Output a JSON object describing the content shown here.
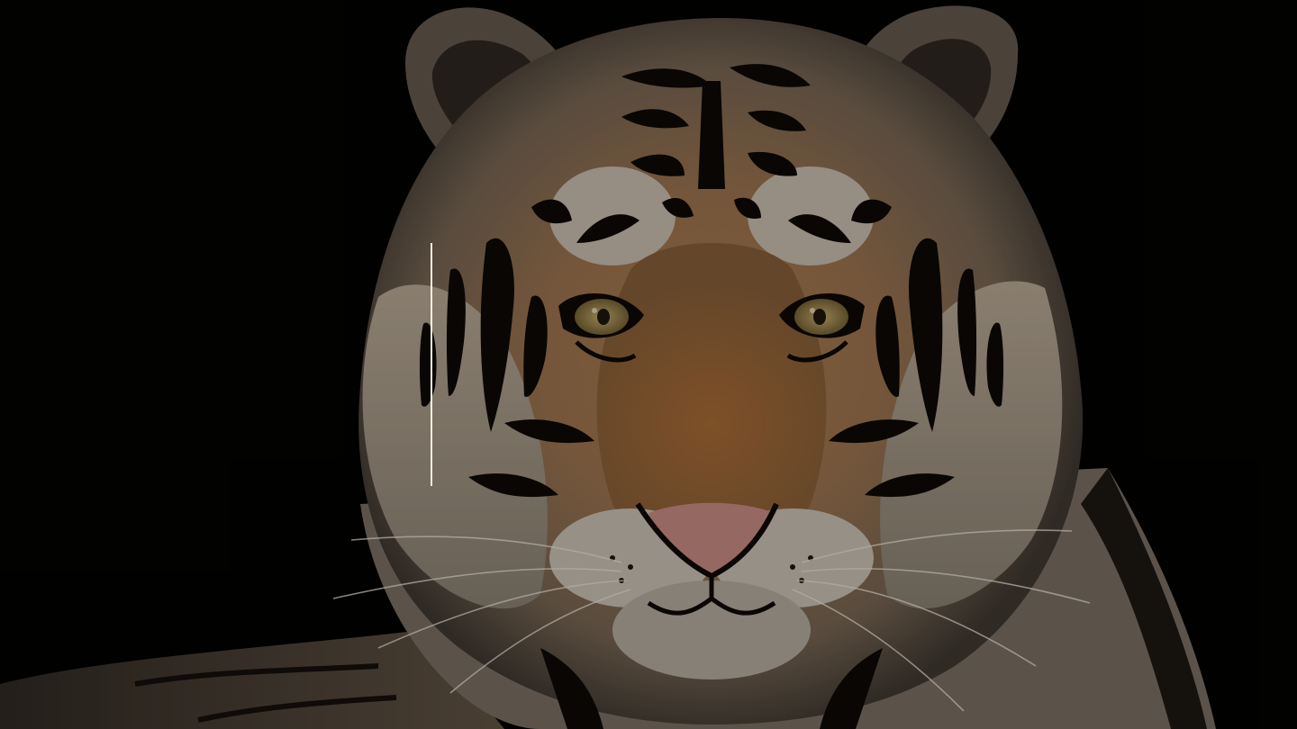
{
  "scene": {
    "subject": "tiger-face",
    "colors": {
      "background": "#020201",
      "fur_orange": "#8a5a2e",
      "fur_light": "#b9a48b",
      "stripe": "#0b0806",
      "nose": "#b77f78",
      "eye": "#8f7a45",
      "rule": "#f4efe6"
    }
  }
}
